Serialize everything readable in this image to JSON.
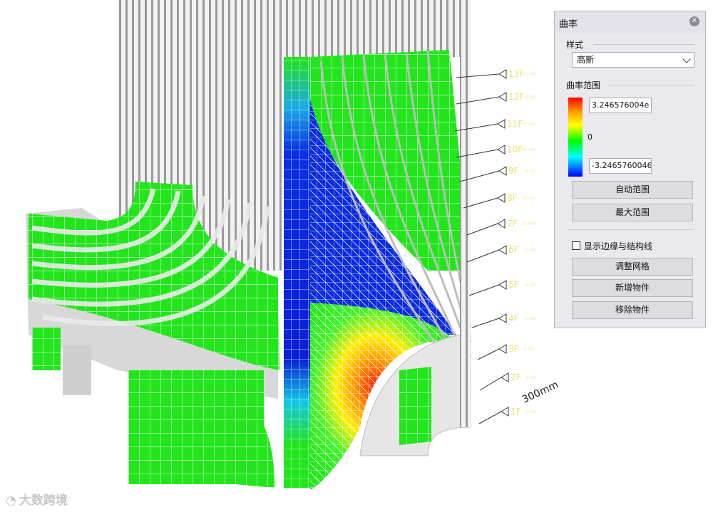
{
  "panel": {
    "title": "曲率",
    "close_icon": "close-icon",
    "style_section": "样式",
    "style_value": "高斯",
    "range_section": "曲率范围",
    "max_value": "3.246576004e",
    "zero_label": "0",
    "min_value": "-3.2465760046",
    "buttons": {
      "auto_range": "自动范围",
      "max_range": "最大范围",
      "adjust_mesh": "调整网格",
      "add_part": "新增物件",
      "remove_part": "移除物件"
    },
    "show_edges_label": "显示边缘与结构线",
    "show_edges_checked": false,
    "gradient_colors": [
      "#ff0000",
      "#ffaa00",
      "#ffff00",
      "#00ff00",
      "#00ffff",
      "#0000ff"
    ]
  },
  "floors": [
    {
      "label": "13F",
      "sub": "43.900"
    },
    {
      "label": "12F",
      "sub": "40.400"
    },
    {
      "label": "11F",
      "sub": "37.400"
    },
    {
      "label": "10F",
      "sub": "33.900"
    },
    {
      "label": "9F",
      "sub": "30.400"
    },
    {
      "label": "8F",
      "sub": "26.900"
    },
    {
      "label": "7F",
      "sub": "23.400"
    },
    {
      "label": "6F",
      "sub": "19.900"
    },
    {
      "label": "5F",
      "sub": "16.400"
    },
    {
      "label": "4F",
      "sub": "12.900"
    },
    {
      "label": "3F",
      "sub": "9.400"
    },
    {
      "label": "2F",
      "sub": "5.900"
    },
    {
      "label": "1F",
      "sub": "0.000"
    }
  ],
  "dimension_label": "300mm",
  "watermark": "大数跨境"
}
